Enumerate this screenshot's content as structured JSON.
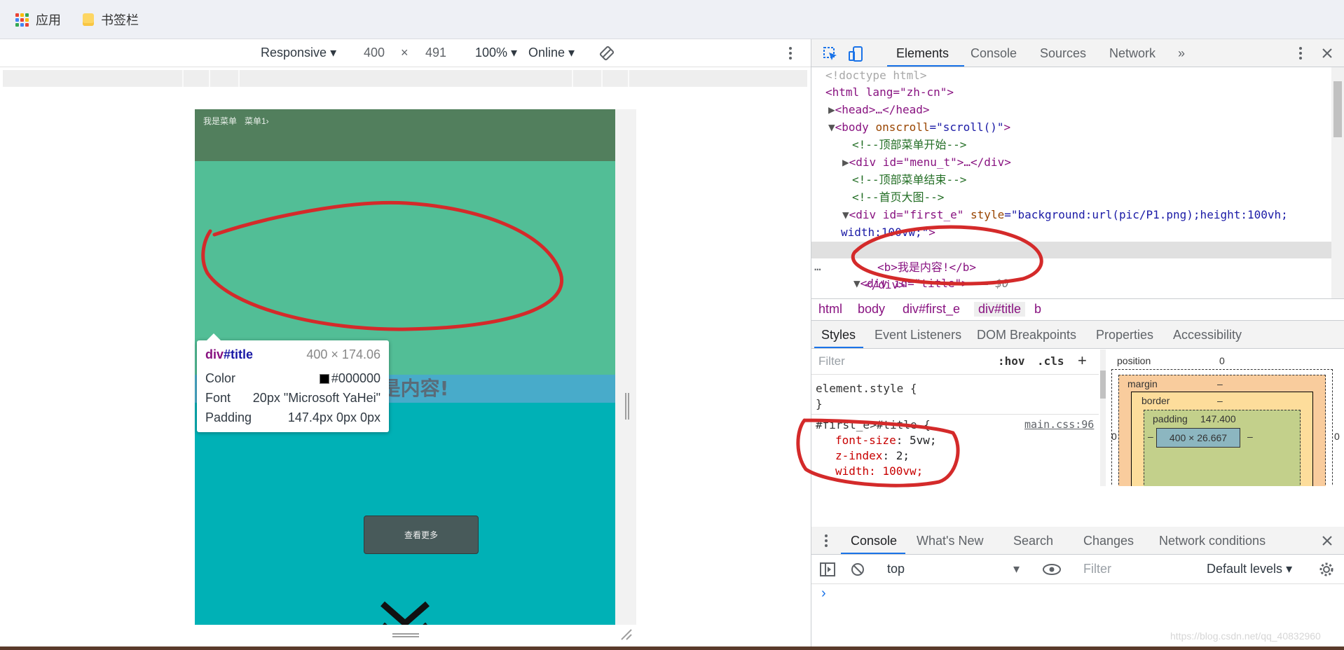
{
  "bookmarks": {
    "apps_label": "应用",
    "folder_label": "书签栏"
  },
  "device_toolbar": {
    "device": "Responsive",
    "width": "400",
    "x_sep": "×",
    "height": "491",
    "zoom": "100%",
    "throttle": "Online"
  },
  "page": {
    "menu_items": [
      "我是菜单",
      "菜单1›"
    ],
    "title": "我是内容!",
    "more_button": "查看更多"
  },
  "tooltip": {
    "selector_tag": "div",
    "selector_id": "#title",
    "size": "400 × 174.06",
    "color_label": "Color",
    "color_value": "#000000",
    "font_label": "Font",
    "font_value": "20px \"Microsoft YaHei\"",
    "padding_label": "Padding",
    "padding_value": "147.4px 0px 0px"
  },
  "devtools": {
    "tabs": [
      "Elements",
      "Console",
      "Sources",
      "Network"
    ],
    "more_tabs": "»",
    "dom": {
      "doctype": "<!doctype html>",
      "html_open": "<html lang=\"zh-cn\">",
      "head": "<head>…</head>",
      "body_tag": "<body",
      "body_attr": " onscroll",
      "body_val": "=\"scroll()\"",
      "body_close": ">",
      "comment1": "<!--顶部菜单开始-->",
      "menu_div": "<div id=\"menu_t\">…</div>",
      "comment2": "<!--顶部菜单结束-->",
      "comment3": "<!--首页大图-->",
      "first_e_a": "<div id=\"first_e\"",
      "first_e_attr": " style",
      "first_e_val": "=\"background:url(pic/P1.png);height:100vh;",
      "first_e_cont": "width:100vw;\"",
      "first_e_close": ">",
      "title_div": "<div id=\"title\">",
      "title_marker": " == $0",
      "b_line": "<b>我是内容!</b>",
      "div_close": "</div>",
      "dots": "…"
    },
    "breadcrumbs": [
      "html",
      "body",
      "div#first_e",
      "div#title",
      "b"
    ],
    "sub_tabs": [
      "Styles",
      "Event Listeners",
      "DOM Breakpoints",
      "Properties",
      "Accessibility"
    ],
    "styles": {
      "filter_placeholder": "Filter",
      "hov": ":hov",
      "cls": ".cls",
      "plus": "+",
      "element_style": "element.style {",
      "element_close": "}",
      "rule_selector": "#first_e>#title {",
      "rule_source": "main.css:96",
      "prop1_name": "font-size",
      "prop1_val": "5vw;",
      "prop2_name": "z-index",
      "prop2_val": "2;",
      "prop3_partial": "width: 100vw;"
    },
    "box_model": {
      "position_label": "position",
      "position_val": "0",
      "margin_label": "margin",
      "margin_val": "–",
      "border_label": "border",
      "border_val": "–",
      "padding_label": "padding",
      "padding_val": "147.400",
      "content_size": "400 × 26.667",
      "side_zero": "0",
      "dash": "–"
    },
    "drawer_tabs": [
      "Console",
      "What's New",
      "Search",
      "Changes",
      "Network conditions"
    ],
    "console": {
      "context": "top",
      "filter_placeholder": "Filter",
      "levels": "Default levels",
      "prompt": "›"
    }
  },
  "watermark": "https://blog.csdn.net/qq_40832960",
  "colors": {
    "menu_bg": "#527f5d",
    "hero_green": "#52be96",
    "title_strip": "#48abca",
    "hero_teal": "#00b1b6",
    "annotation_red": "#d42a2a",
    "devtools_accent": "#1a73e8"
  }
}
